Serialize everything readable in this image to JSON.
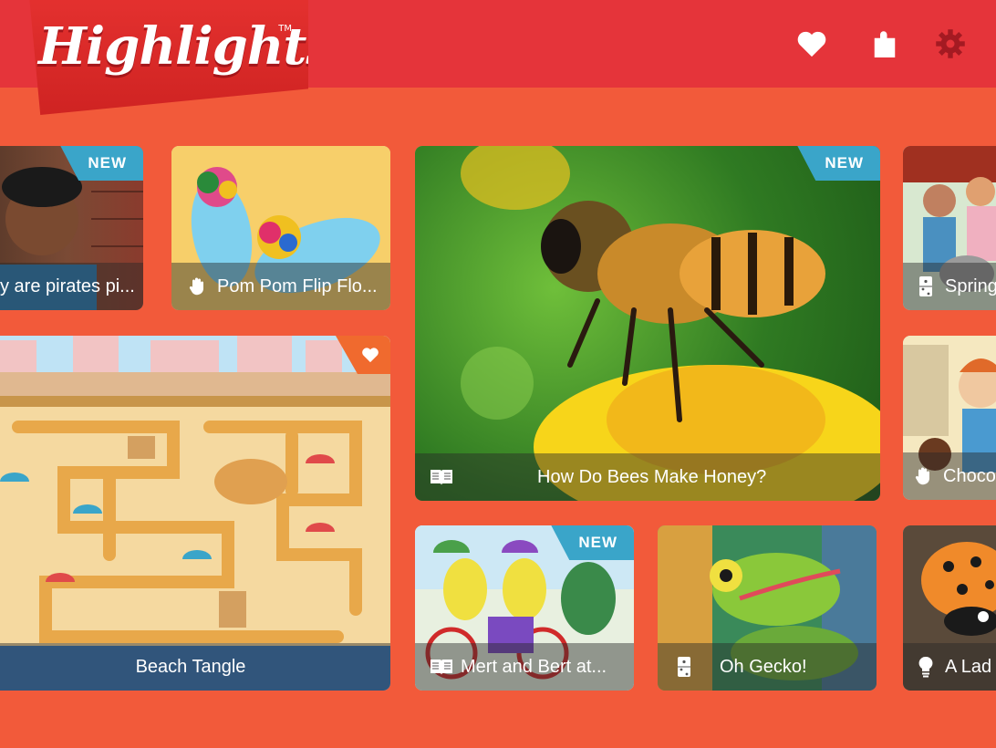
{
  "app": {
    "brand": "Highlights",
    "tm": "TM"
  },
  "header_icons": [
    {
      "name": "favorites-heart-icon"
    },
    {
      "name": "puzzle-icon"
    },
    {
      "name": "settings-gear-icon"
    }
  ],
  "tiles": {
    "pirates": {
      "caption": "y are pirates pi...",
      "badge": "NEW"
    },
    "flipflops": {
      "caption": "Pom Pom Flip Flo..."
    },
    "bees": {
      "caption": "How Do Bees Make Honey?",
      "badge": "NEW"
    },
    "spring": {
      "caption": "Spring"
    },
    "beach": {
      "caption": "Beach Tangle"
    },
    "choco": {
      "caption": "Choco"
    },
    "mert": {
      "caption": "Mert and Bert at...",
      "badge": "NEW"
    },
    "gecko": {
      "caption": "Oh Gecko!"
    },
    "ladybug": {
      "caption": "A Lad"
    }
  },
  "colors": {
    "background": "#f25a3a",
    "header": "#e5343a",
    "badge": "#3aa5c9"
  }
}
